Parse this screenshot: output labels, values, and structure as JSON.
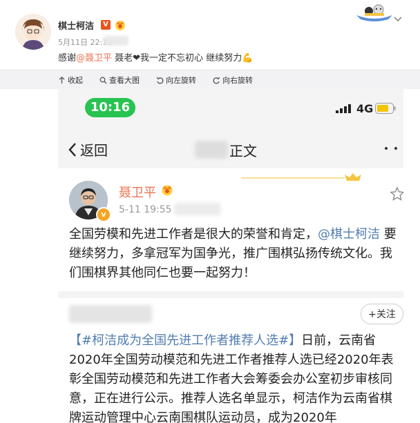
{
  "post": {
    "username": "棋士柯洁",
    "badge_v": "V",
    "timestamp": "5月11日 22:19",
    "text_prefix": "感谢",
    "mention": "@聂卫平",
    "text_suffix": " 聂老❤我一定不忘初心 继续努力💪"
  },
  "toolbar": {
    "collapse": "收起",
    "view_large": "查看大图",
    "rotate_left": "向左旋转",
    "rotate_right": "向右旋转"
  },
  "phone": {
    "status_time": "10:16",
    "network": "4G",
    "nav_back": "返回",
    "nav_title": "正文"
  },
  "quoted_post": {
    "author": "聂卫平",
    "timestamp": "5-11 19:55",
    "body_1": "全国劳模和先进工作者是很大的荣誉和肯定，",
    "mention": "@棋士柯洁",
    "body_2": " 要继续努力，多拿冠军为国争光，推广围棋弘扬传统文化。我们围棋界其他同仁也要一起努力！"
  },
  "second_post": {
    "follow_label": "+关注",
    "hashtag": "【#柯洁成为全国先进工作者推荐人选#】",
    "body": "日前，云南省2020年全国劳动模范和先进工作者推荐人选已经2020年表彰全国劳动模范和先进工作者大会筹委会办公室初步审核同意，正在进行公示。推荐人选名单显示，柯洁作为云南省棋牌运动管理中心云南围棋队运动员，成为2020年"
  },
  "colors": {
    "mention_orange": "#eb7350",
    "link_blue": "#507daf",
    "status_green": "#28c350"
  },
  "icons": [
    "v-badge-icon",
    "vip-crown-icon",
    "expand-chevron-icon",
    "collapse-icon",
    "magnify-icon",
    "rotate-left-icon",
    "rotate-right-icon",
    "signal-icon",
    "battery-icon",
    "back-chevron-icon",
    "more-dots-icon",
    "star-icon",
    "verified-icon"
  ]
}
